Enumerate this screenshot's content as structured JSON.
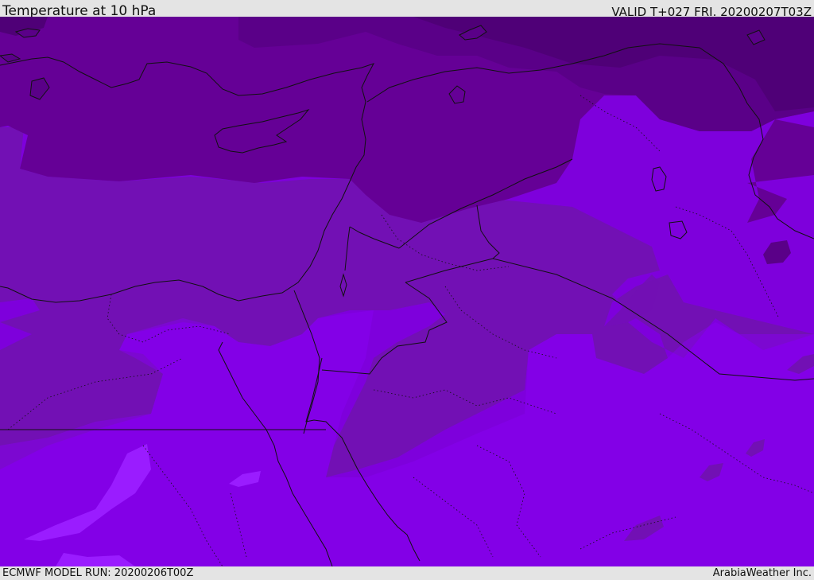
{
  "header": {
    "title": "Temperature at 10 hPa",
    "valid_time": "VALID T+027 FRI. 20200207T03Z"
  },
  "footer": {
    "model_run": "ECMWF MODEL RUN: 20200206T00Z",
    "credit": "ArabiaWeather Inc."
  },
  "colors": {
    "band_coldest": "#4f0077",
    "band_cold": "#5a0088",
    "band_mid": "#650096",
    "band_mild": "#7210b4",
    "band_warm": "#7e00dc",
    "band_warmest": "#8a00f4",
    "patch_peak": "#9a1cff",
    "borders": "#111111"
  }
}
